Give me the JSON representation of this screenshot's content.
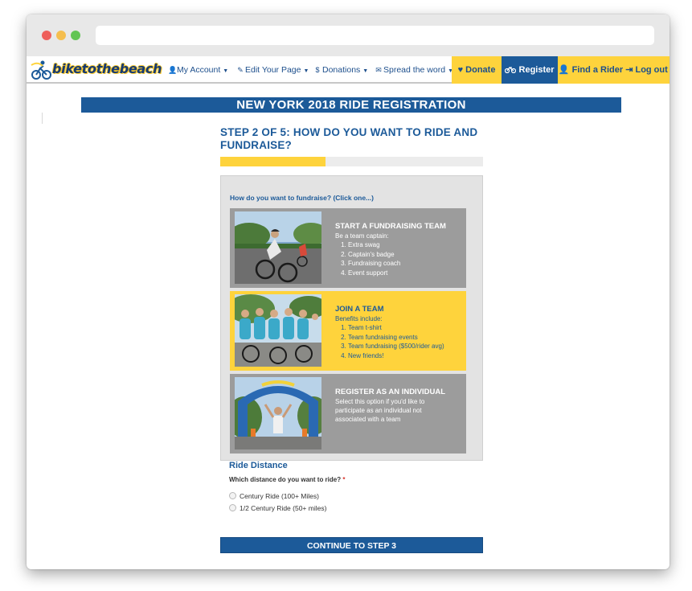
{
  "nav": {
    "brand": "biketothebeach",
    "items": [
      {
        "icon": "user-icon",
        "glyph": "👤",
        "label": "My Account"
      },
      {
        "icon": "edit-icon",
        "glyph": "✎",
        "label": "Edit Your Page"
      },
      {
        "icon": "dollar-icon",
        "glyph": "$",
        "label": "Donations"
      },
      {
        "icon": "envelope-icon",
        "glyph": "✉",
        "label": "Spread the word"
      }
    ],
    "donate": "Donate",
    "register": "Register",
    "find_rider": "Find a Rider",
    "logout": "Log out",
    "colors": {
      "accent_yellow": "#fed33c",
      "brand_blue": "#1c5a99"
    }
  },
  "page": {
    "banner": "NEW YORK 2018 RIDE REGISTRATION",
    "step_title": "STEP 2 OF 5: HOW DO YOU WANT TO RIDE AND FUNDRAISE?",
    "progress_fraction": 0.4
  },
  "fundraise": {
    "prompt": "How do you want to fundraise? (Click one...)",
    "options": [
      {
        "title": "START A FUNDRAISING TEAM",
        "subtitle": "Be a team captain:",
        "list": [
          "Extra swag",
          "Captain's badge",
          "Fundraising coach",
          "Event support"
        ]
      },
      {
        "title": "JOIN A TEAM",
        "subtitle": "Benefits include:",
        "list": [
          "Team t-shirt",
          "Team fundraising events",
          "Team fundraising ($500/rider avg)",
          "New friends!"
        ]
      },
      {
        "title": "REGISTER AS AN INDIVIDUAL",
        "subtitle": "Select this option if you'd like to participate as an individual not associated with a team"
      }
    ]
  },
  "ride": {
    "heading": "Ride Distance",
    "question": "Which distance do you want to ride?",
    "required_mark": "*",
    "options": [
      "Century Ride (100+ Miles)",
      "1/2 Century Ride (50+ miles)"
    ]
  },
  "continue_label": "CONTINUE TO STEP 3"
}
